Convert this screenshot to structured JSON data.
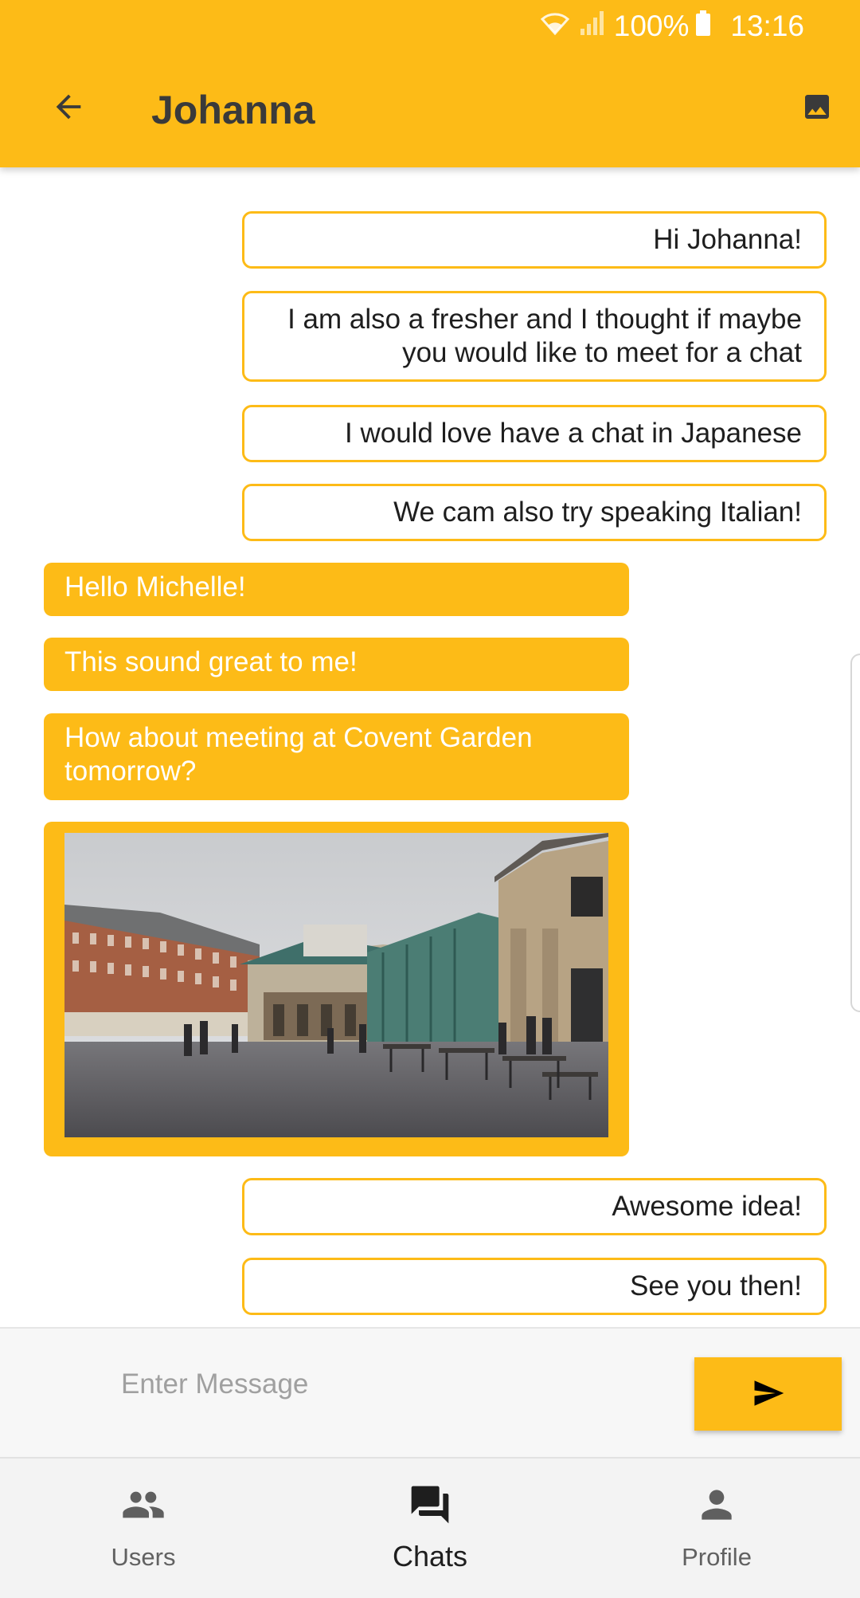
{
  "status_bar": {
    "battery": "100%",
    "time": "13:16"
  },
  "header": {
    "title": "Johanna",
    "back_icon": "arrow-back-icon",
    "image_icon": "image-icon"
  },
  "messages": [
    {
      "type": "outgoing",
      "text": "Hi Johanna!"
    },
    {
      "type": "outgoing",
      "text": "I am also a fresher and I thought if maybe you would like to meet for a chat"
    },
    {
      "type": "outgoing",
      "text": "I would love have a chat in Japanese"
    },
    {
      "type": "outgoing",
      "text": "We cam also try speaking Italian!"
    },
    {
      "type": "incoming",
      "text": "Hello Michelle!"
    },
    {
      "type": "incoming",
      "text": "This sound great to me!"
    },
    {
      "type": "incoming",
      "text": "How about meeting at Covent Garden tomorrow?"
    },
    {
      "type": "incoming-image",
      "image": "covent-garden-photo"
    },
    {
      "type": "outgoing",
      "text": "Awesome idea!"
    },
    {
      "type": "outgoing",
      "text": "See you then!"
    }
  ],
  "composer": {
    "placeholder": "Enter Message",
    "value": "",
    "send_icon": "send-icon"
  },
  "nav": {
    "items": [
      {
        "label": "Users",
        "icon": "people-icon",
        "active": false
      },
      {
        "label": "Chats",
        "icon": "chat-icon",
        "active": true
      },
      {
        "label": "Profile",
        "icon": "person-icon",
        "active": false
      }
    ]
  },
  "colors": {
    "accent": "#FDBB17",
    "outgoing_bg": "#FFFFFF",
    "incoming_text": "#FFFFFF"
  }
}
